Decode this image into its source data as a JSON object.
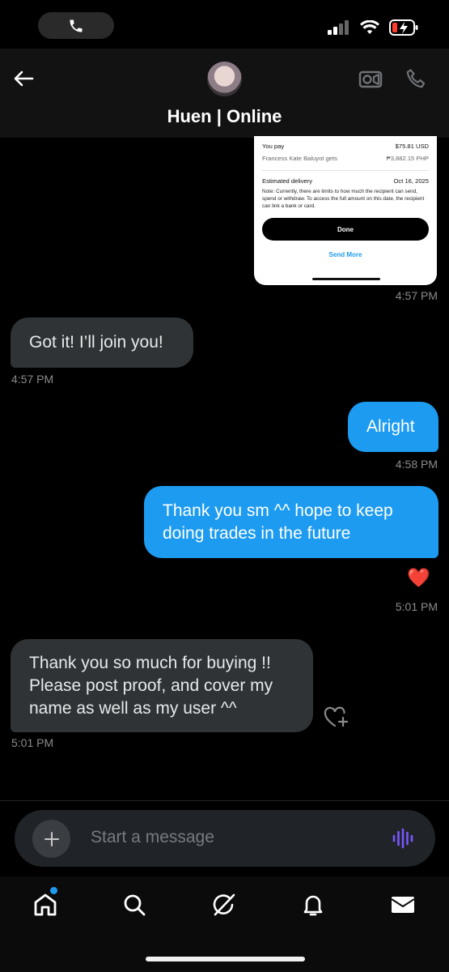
{
  "header": {
    "title": "Huen | Online"
  },
  "receipt": {
    "you_pay_label": "You pay",
    "you_pay_value": "$75.81 USD",
    "recipient_label": "Francess Kate Baluyot gets",
    "recipient_value": "₱3,882.15 PHP",
    "delivery_label": "Estimated delivery",
    "delivery_value": "Oct 16, 2025",
    "note": "Note: Currently, there are limits to how much the recipient can send, spend or withdraw. To access the full amount on this date, the recipient can link a bank or card.",
    "done_label": "Done",
    "send_more_label": "Send More"
  },
  "messages": [
    {
      "direction": "outgoing",
      "type": "image",
      "time": "4:57 PM"
    },
    {
      "direction": "incoming",
      "text": "Got it! I’ll join you!",
      "time": "4:57 PM"
    },
    {
      "direction": "outgoing",
      "text": "Alright",
      "time": "4:58 PM"
    },
    {
      "direction": "outgoing",
      "text": "Thank you sm ^^ hope to keep doing trades in the future",
      "reaction": "❤️",
      "time": "5:01 PM"
    },
    {
      "direction": "incoming",
      "text": "Thank you so much for buying !! Please post proof, and cover my name as well as my user ^^",
      "time": "5:01 PM"
    }
  ],
  "composer": {
    "placeholder": "Start a message",
    "accent_color": "#7856ff"
  },
  "tabs": [
    {
      "icon": "home-icon",
      "badge": true
    },
    {
      "icon": "search-icon"
    },
    {
      "icon": "grok-icon"
    },
    {
      "icon": "bell-icon"
    },
    {
      "icon": "mail-icon"
    }
  ],
  "colors": {
    "outgoing_bubble": "#1d9bf0",
    "incoming_bubble": "#2f3336",
    "background": "#000000"
  }
}
